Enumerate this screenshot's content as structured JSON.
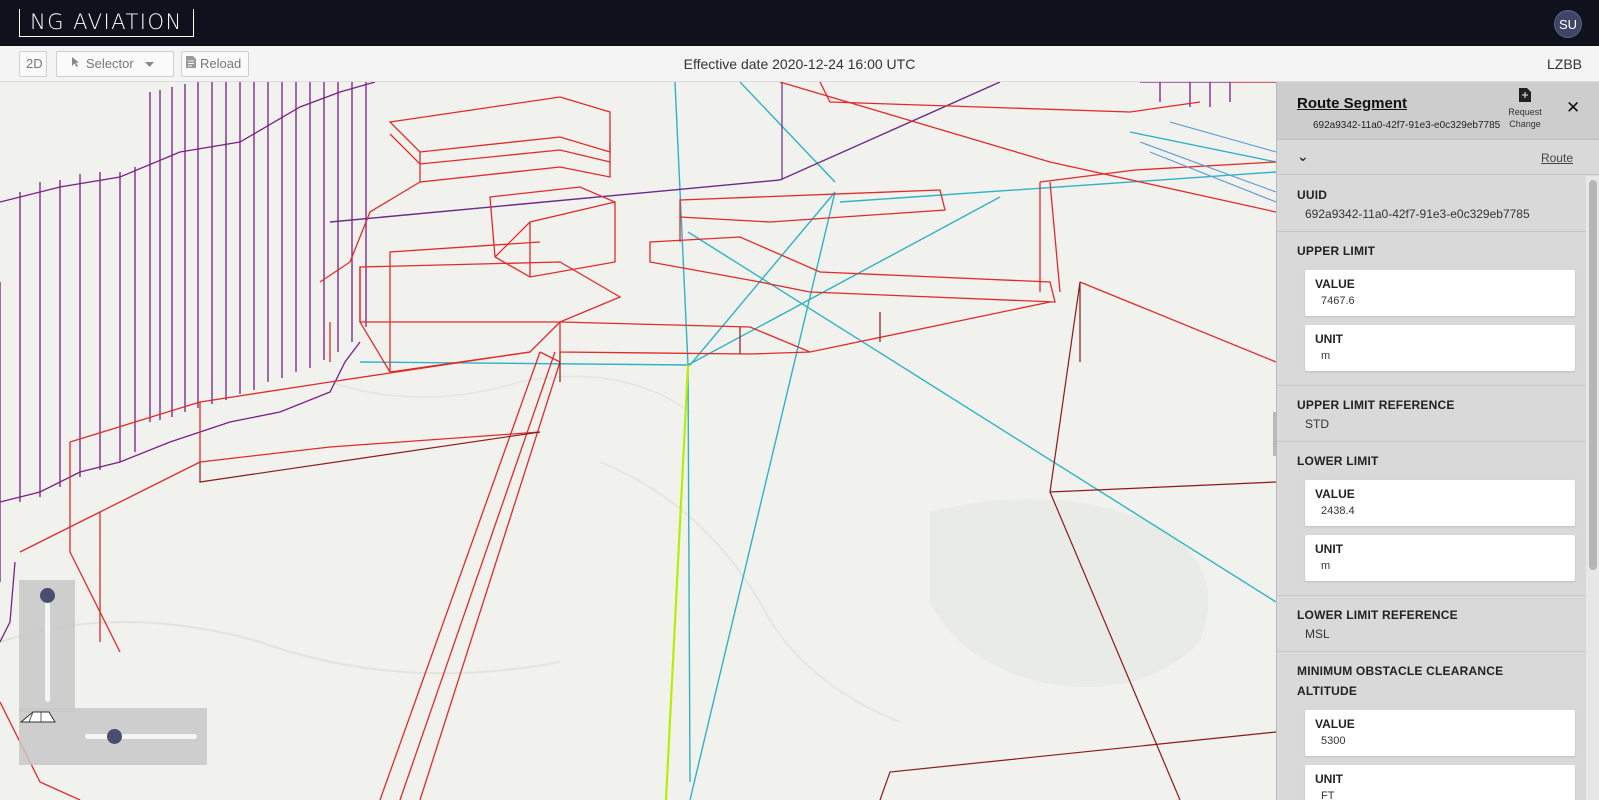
{
  "app": {
    "brand": "NG AVIATION",
    "user_initials": "SU"
  },
  "toolbar": {
    "view_mode_label": "2D",
    "selector_label": "Selector",
    "reload_label": "Reload",
    "effective_date": "Effective date 2020-12-24 16:00 UTC",
    "region": "LZBB"
  },
  "panel": {
    "title": "Route Segment",
    "id": "692a9342-11a0-42f7-91e3-e0c329eb7785",
    "request_change_line1": "Request",
    "request_change_line2": "Change",
    "close_symbol": "✕",
    "collapse_symbol": "⌄",
    "route_link": "Route",
    "uuid_label": "UUID",
    "uuid_value": "692a9342-11a0-42f7-91e3-e0c329eb7785",
    "upper_limit": {
      "label": "UPPER LIMIT",
      "value_label": "VALUE",
      "value": "7467.6",
      "unit_label": "UNIT",
      "unit": "m"
    },
    "upper_limit_reference": {
      "label": "UPPER LIMIT REFERENCE",
      "value": "STD"
    },
    "lower_limit": {
      "label": "LOWER LIMIT",
      "value_label": "VALUE",
      "value": "2438.4",
      "unit_label": "UNIT",
      "unit": "m"
    },
    "lower_limit_reference": {
      "label": "LOWER LIMIT REFERENCE",
      "value": "MSL"
    },
    "min_obstacle_clearance": {
      "label_line1": "MINIMUM OBSTACLE CLEARANCE",
      "label_line2": "ALTITUDE",
      "value_label": "VALUE",
      "value": "5300",
      "unit_label": "UNIT",
      "unit": "FT"
    }
  },
  "map": {
    "icons": {
      "pitch": "pitch-icon",
      "selector": "cursor-arrow-icon",
      "reload": "document-icon"
    },
    "colors": {
      "airspace": "#e02b2b",
      "airspace_dark": "#8b1a1a",
      "restricted": "#7a1f86",
      "route": "#2fb3c4",
      "selected_route": "#b6f000"
    }
  }
}
